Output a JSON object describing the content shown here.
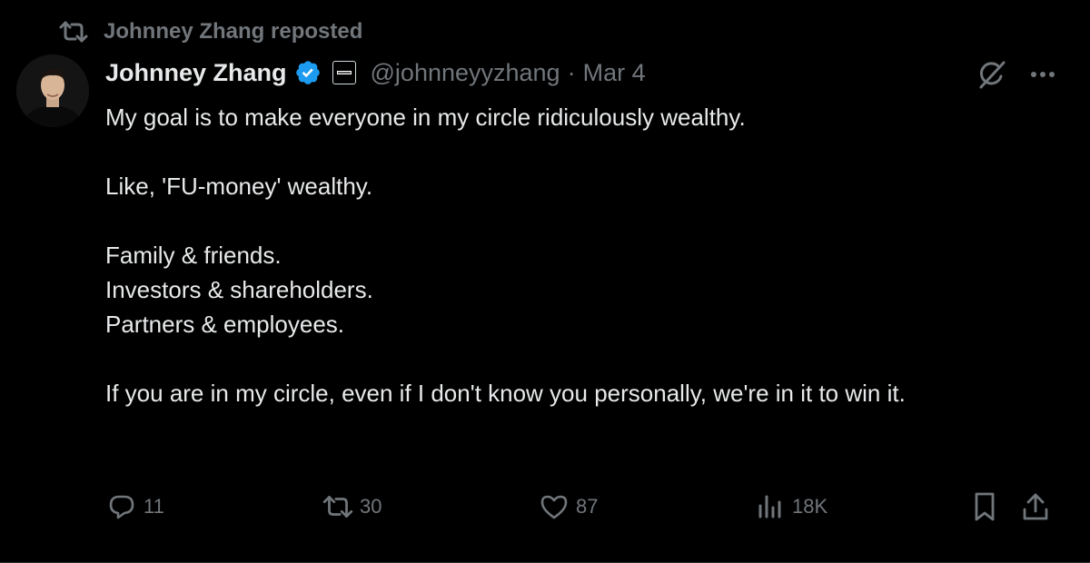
{
  "social_context": {
    "text": "Johnney Zhang reposted",
    "icon": "repost-icon"
  },
  "author": {
    "name": "Johnney Zhang",
    "handle": "@johnneyyzhang",
    "separator": "·",
    "date": "Mar 4",
    "verified_icon": "verified-badge-icon",
    "affiliate_icon": "affiliate-badge-icon",
    "avatar": "avatar"
  },
  "header_actions": {
    "grok_icon": "grok-icon",
    "more_icon": "more-icon"
  },
  "tweet": {
    "line1": "My goal is to make everyone in my circle ridiculously wealthy.",
    "line2": "Like, 'FU-money' wealthy.",
    "line3": "Family & friends.",
    "line4": "Investors & shareholders.",
    "line5": "Partners & employees.",
    "line6": "If you are in my circle, even if I don't know you personally, we're in it to win it."
  },
  "actions": {
    "replies": "11",
    "reposts": "30",
    "likes": "87",
    "views": "18K",
    "reply_icon": "reply-icon",
    "repost_icon": "repost-icon",
    "like_icon": "heart-icon",
    "views_icon": "views-chart-icon",
    "bookmark_icon": "bookmark-icon",
    "share_icon": "share-icon"
  },
  "colors": {
    "background": "#000000",
    "text_primary": "#e7e9ea",
    "text_secondary": "#71767b",
    "verified_blue": "#1d9bf0"
  }
}
